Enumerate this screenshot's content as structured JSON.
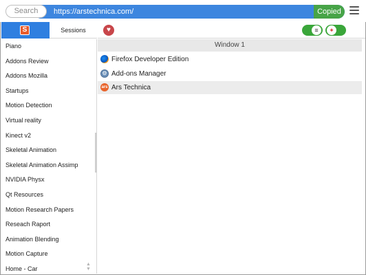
{
  "toolbar": {
    "search_placeholder": "Search",
    "url": "https://arstechnica.com/",
    "copied_label": "Copied"
  },
  "sidebar_tabs": {
    "primary_icon": "S",
    "sessions_label": "Sessions"
  },
  "sessions": [
    "Piano",
    "Addons Review",
    "Addons Mozilla",
    "Startups",
    "Motion Detection",
    "Virtual reality",
    "Kinect v2",
    "Skeletal Animation",
    "Skeletal Animation Assimp",
    "NVIDIA Physx",
    "Qt Resources",
    "Motion Research Papers",
    "Reseach Raport",
    "Animation Blending",
    "Motion Capture",
    "Home - Car"
  ],
  "window": {
    "title": "Window 1",
    "tabs": [
      {
        "title": "Firefox Developer Edition",
        "icon": "firefox-icon",
        "selected": false
      },
      {
        "title": "Add-ons Manager",
        "icon": "addons-icon",
        "selected": false
      },
      {
        "title": "Ars Technica",
        "icon": "ars-technica-icon",
        "selected": true
      }
    ]
  },
  "icons": {
    "heart": "heart-icon",
    "stack": "stack-icon",
    "pin": "pin-icon",
    "menu": "hamburger-menu-icon"
  },
  "colors": {
    "accent_blue": "#3d86df",
    "copied_green": "#47a447",
    "toggle_green": "#3aa63a",
    "heart_red": "#c8464a"
  }
}
